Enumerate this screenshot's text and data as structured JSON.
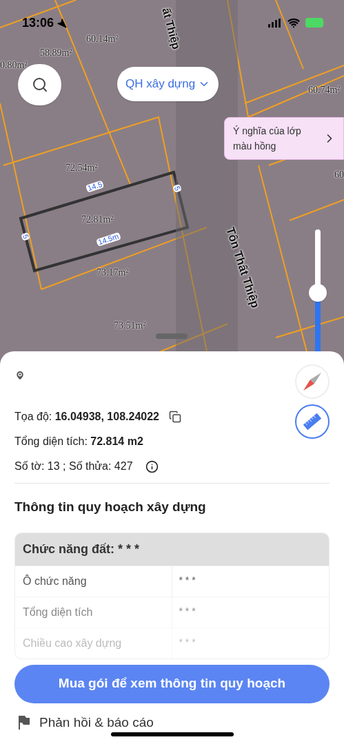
{
  "status_bar": {
    "time": "13:06"
  },
  "map": {
    "parcel_labels": [
      "60.14m²",
      "58.89m²",
      "0.80m²",
      "60.74m²",
      "72.54m²",
      "72.81m²",
      "73.17m²",
      "73.51m²",
      "60"
    ],
    "dimension_labels": [
      "14.5",
      "5",
      "5",
      "14.5m"
    ],
    "street_labels": [
      "Tôn Thất Thiệp",
      "ất Thiệp"
    ],
    "layer_dropdown": {
      "label": "QH xây dựng"
    },
    "legend_button": {
      "label": "Ý nghĩa của lớp màu hồng"
    },
    "zoom_slider": {
      "level": 0.48
    }
  },
  "details": {
    "coordinates": {
      "label": "Tọa độ:",
      "value": "16.04938, 108.24022"
    },
    "area": {
      "label": "Tổng diện tích:",
      "value": "72.814 m2"
    },
    "parcel": "Số tờ: 13 ; Số thửa: 427"
  },
  "planning": {
    "title": "Thông tin quy hoạch xây dựng",
    "header": "Chức năng đất: * * *",
    "rows": [
      {
        "label": "Ô chức năng",
        "value": "* * *"
      },
      {
        "label": "Tổng diện tích",
        "value": "* * *"
      },
      {
        "label": "Chiều cao xây dựng",
        "value": "* * *"
      }
    ],
    "buy_button": "Mua gói để xem thông tin quy hoạch"
  },
  "footer_item": "Phản hồi & báo cáo"
}
